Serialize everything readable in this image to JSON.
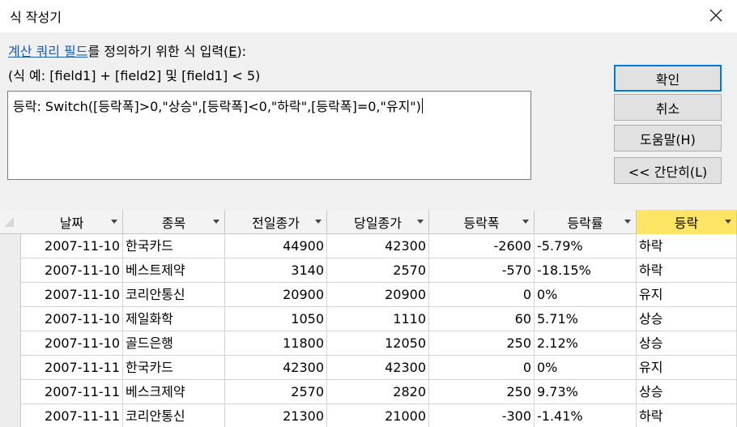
{
  "dialog": {
    "title": "식 작성기",
    "prompt_link": "계산 쿼리 필드",
    "prompt_rest": "를 정의하기 위한 식 입력(",
    "prompt_accel": "E",
    "prompt_end": "):",
    "example": "(식 예: [field1] + [field2] 및 [field1] < 5)",
    "expression": "등락: Switch([등락폭]>0,\"상승\",[등락폭]<0,\"하락\",[등락폭]=0,\"유지\")"
  },
  "buttons": {
    "ok": "확인",
    "cancel": "취소",
    "help": "도움말(H)",
    "less": "<< 간단히(L)"
  },
  "table": {
    "columns": [
      "날짜",
      "종목",
      "전일종가",
      "당일종가",
      "등락폭",
      "등락률",
      "등락"
    ],
    "rows": [
      [
        "2007-11-10",
        "한국카드",
        "44900",
        "42300",
        "-2600",
        "-5.79%",
        "하락"
      ],
      [
        "2007-11-10",
        "베스트제약",
        "3140",
        "2570",
        "-570",
        "-18.15%",
        "하락"
      ],
      [
        "2007-11-10",
        "코리안통신",
        "20900",
        "20900",
        "0",
        "0%",
        "유지"
      ],
      [
        "2007-11-10",
        "제일화학",
        "1050",
        "1110",
        "60",
        "5.71%",
        "상승"
      ],
      [
        "2007-11-10",
        "골드은행",
        "11800",
        "12050",
        "250",
        "2.12%",
        "상승"
      ],
      [
        "2007-11-11",
        "한국카드",
        "42300",
        "42300",
        "0",
        "0%",
        "유지"
      ],
      [
        "2007-11-11",
        "베스크제약",
        "2570",
        "2820",
        "250",
        "9.73%",
        "상승"
      ],
      [
        "2007-11-11",
        "코리안통신",
        "21300",
        "21000",
        "-300",
        "-1.41%",
        "하락"
      ]
    ]
  },
  "colors": {
    "selected_header": "#ffe566",
    "link": "#1a5fb4",
    "focus_border": "#0078d7"
  },
  "icons": {
    "close": "close-icon",
    "dropdown": "chevron-down-icon",
    "select_all": "select-all-icon"
  }
}
